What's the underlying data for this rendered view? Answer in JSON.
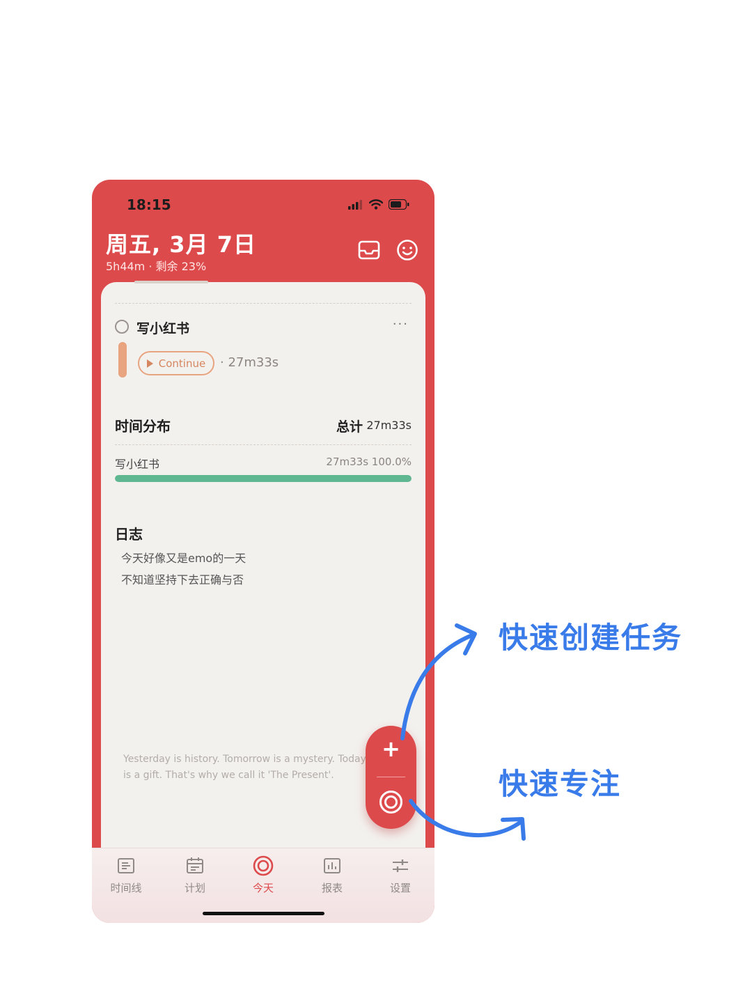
{
  "status_bar": {
    "time": "18:15"
  },
  "header": {
    "title": "周五, 3月 7日",
    "subtitle": "5h44m · 剩余 23%"
  },
  "task": {
    "title": "写小红书",
    "more": "···",
    "continue_label": "Continue",
    "elapsed": "· 27m33s",
    "color": "#e8a37f"
  },
  "distribution": {
    "title": "时间分布",
    "total_label": "总计",
    "total_value": "27m33s",
    "items": [
      {
        "name": "写小红书",
        "value": "27m33s 100.0%",
        "fraction": 1.0,
        "color": "#5fb792"
      }
    ]
  },
  "log": {
    "title": "日志",
    "lines": [
      "今天好像又是emo的一天",
      "不知道坚持下去正确与否"
    ]
  },
  "quote": "Yesterday is history. Tomorrow is a mystery. Today is a gift. That's why we call it 'The Present'.",
  "fab": {
    "plus": "+"
  },
  "tabs": [
    {
      "label": "时间线",
      "icon": "timeline-icon"
    },
    {
      "label": "计划",
      "icon": "calendar-icon"
    },
    {
      "label": "今天",
      "icon": "focus-icon",
      "active": true
    },
    {
      "label": "报表",
      "icon": "report-icon"
    },
    {
      "label": "设置",
      "icon": "sliders-icon"
    }
  ],
  "annotations": {
    "quick_create": "快速创建任务",
    "quick_focus": "快速专注"
  },
  "colors": {
    "accent": "#dd4a4c",
    "annotation": "#3a7bea",
    "progress": "#5fb792"
  }
}
